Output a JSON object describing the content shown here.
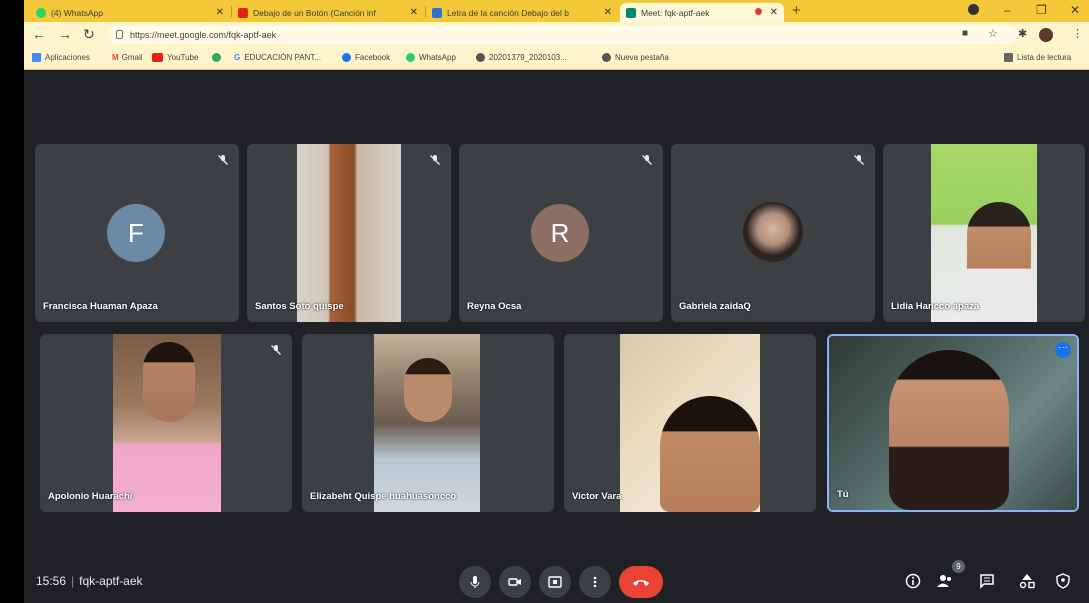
{
  "browser": {
    "tabs": [
      {
        "title": "(4) WhatsApp",
        "fav_color": "#25d366"
      },
      {
        "title": "Debajo de un Botón (Canción inf",
        "fav_color": "#e62117"
      },
      {
        "title": "Letra de la canción Debajo del b",
        "fav_color": "#2f6fd1"
      },
      {
        "title": "Meet: fqk-aptf-aek",
        "fav_color": "#00897b",
        "active": true
      }
    ],
    "url": "https://meet.google.com/fqk-aptf-aek",
    "bookmarks": [
      {
        "label": "Aplicaciones",
        "icon": "apps-grid-icon",
        "color": "#4285f4"
      },
      {
        "label": "Gmail",
        "icon": "gmail-icon",
        "color": "#ea4335"
      },
      {
        "label": "YouTube",
        "icon": "youtube-icon",
        "color": "#e62117"
      },
      {
        "label": "",
        "icon": "green-site-icon",
        "color": "#34a853"
      },
      {
        "label": "EDUCACIÓN PANT...",
        "icon": "google-g-icon",
        "color": "#4285f4"
      },
      {
        "label": "Facebook",
        "icon": "facebook-icon",
        "color": "#1877f2"
      },
      {
        "label": "WhatsApp",
        "icon": "whatsapp-icon",
        "color": "#25d366"
      },
      {
        "label": "20201379_2020103...",
        "icon": "globe-icon",
        "color": "#555555"
      },
      {
        "label": "Nueva pestaña",
        "icon": "globe-icon",
        "color": "#555555"
      }
    ],
    "reading_list": "Lista de lectura"
  },
  "participants": [
    {
      "name": "Francisca Huaman Apaza",
      "avatar_letter": "F",
      "avatar_color": "#6b8aa5",
      "muted": true,
      "type": "avatar"
    },
    {
      "name": "Santos Soto quispe",
      "muted": true,
      "type": "video"
    },
    {
      "name": "Reyna Ocsa",
      "avatar_letter": "R",
      "avatar_color": "#8d6e63",
      "muted": true,
      "type": "avatar"
    },
    {
      "name": "Gabriela zaidaQ",
      "muted": true,
      "type": "photo"
    },
    {
      "name": "Lidia Hancco apaza",
      "muted": false,
      "type": "video"
    },
    {
      "name": "Apolonio Huarachi",
      "muted": true,
      "type": "video"
    },
    {
      "name": "Elizabeht Quispe huahuasoncco",
      "muted": false,
      "type": "video"
    },
    {
      "name": "Victor Vara",
      "muted": false,
      "type": "video"
    },
    {
      "name": "Tú",
      "muted": false,
      "type": "video",
      "selected": true
    }
  ],
  "meeting": {
    "time": "15:56",
    "code": "fqk-aptf-aek",
    "participant_count": "9"
  },
  "colors": {
    "background": "#202124",
    "tile": "#3c4043",
    "end_call": "#ea4335",
    "accent": "#8ab4f8"
  }
}
